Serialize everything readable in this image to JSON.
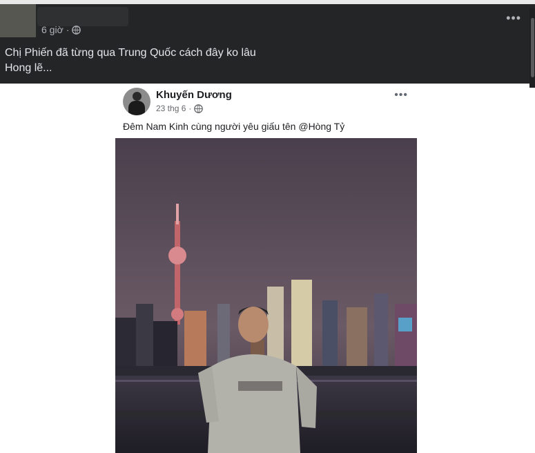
{
  "outer_post": {
    "time": "6 giờ",
    "text_lines": [
      "Chị Phiến đã từng qua Trung Quốc cách đây ko lâu",
      "Hong lẽ..."
    ]
  },
  "embedded_post": {
    "author": "Khuyến Dương",
    "date": "23 thg 6",
    "caption": "Đêm Nam Kinh cùng người yêu giấu tên @Hòng Tỷ"
  },
  "icons": {
    "privacy": "globe-icon",
    "more": "more-options-icon"
  },
  "colors": {
    "dark_bg": "#242526",
    "dark_text": "#e4e6eb",
    "muted_text": "#b0b3b8",
    "link_name": "#1c1e21"
  }
}
